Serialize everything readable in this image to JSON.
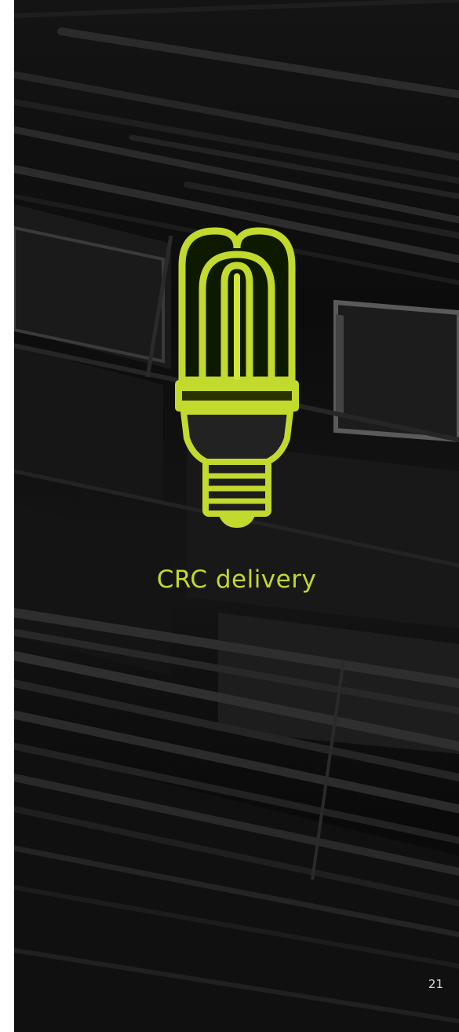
{
  "title": "CRC delivery",
  "page_number": "21",
  "icon": "energy-saving-bulb-icon",
  "colors": {
    "accent": "#c2d92e",
    "background": "#0f0f0f"
  }
}
